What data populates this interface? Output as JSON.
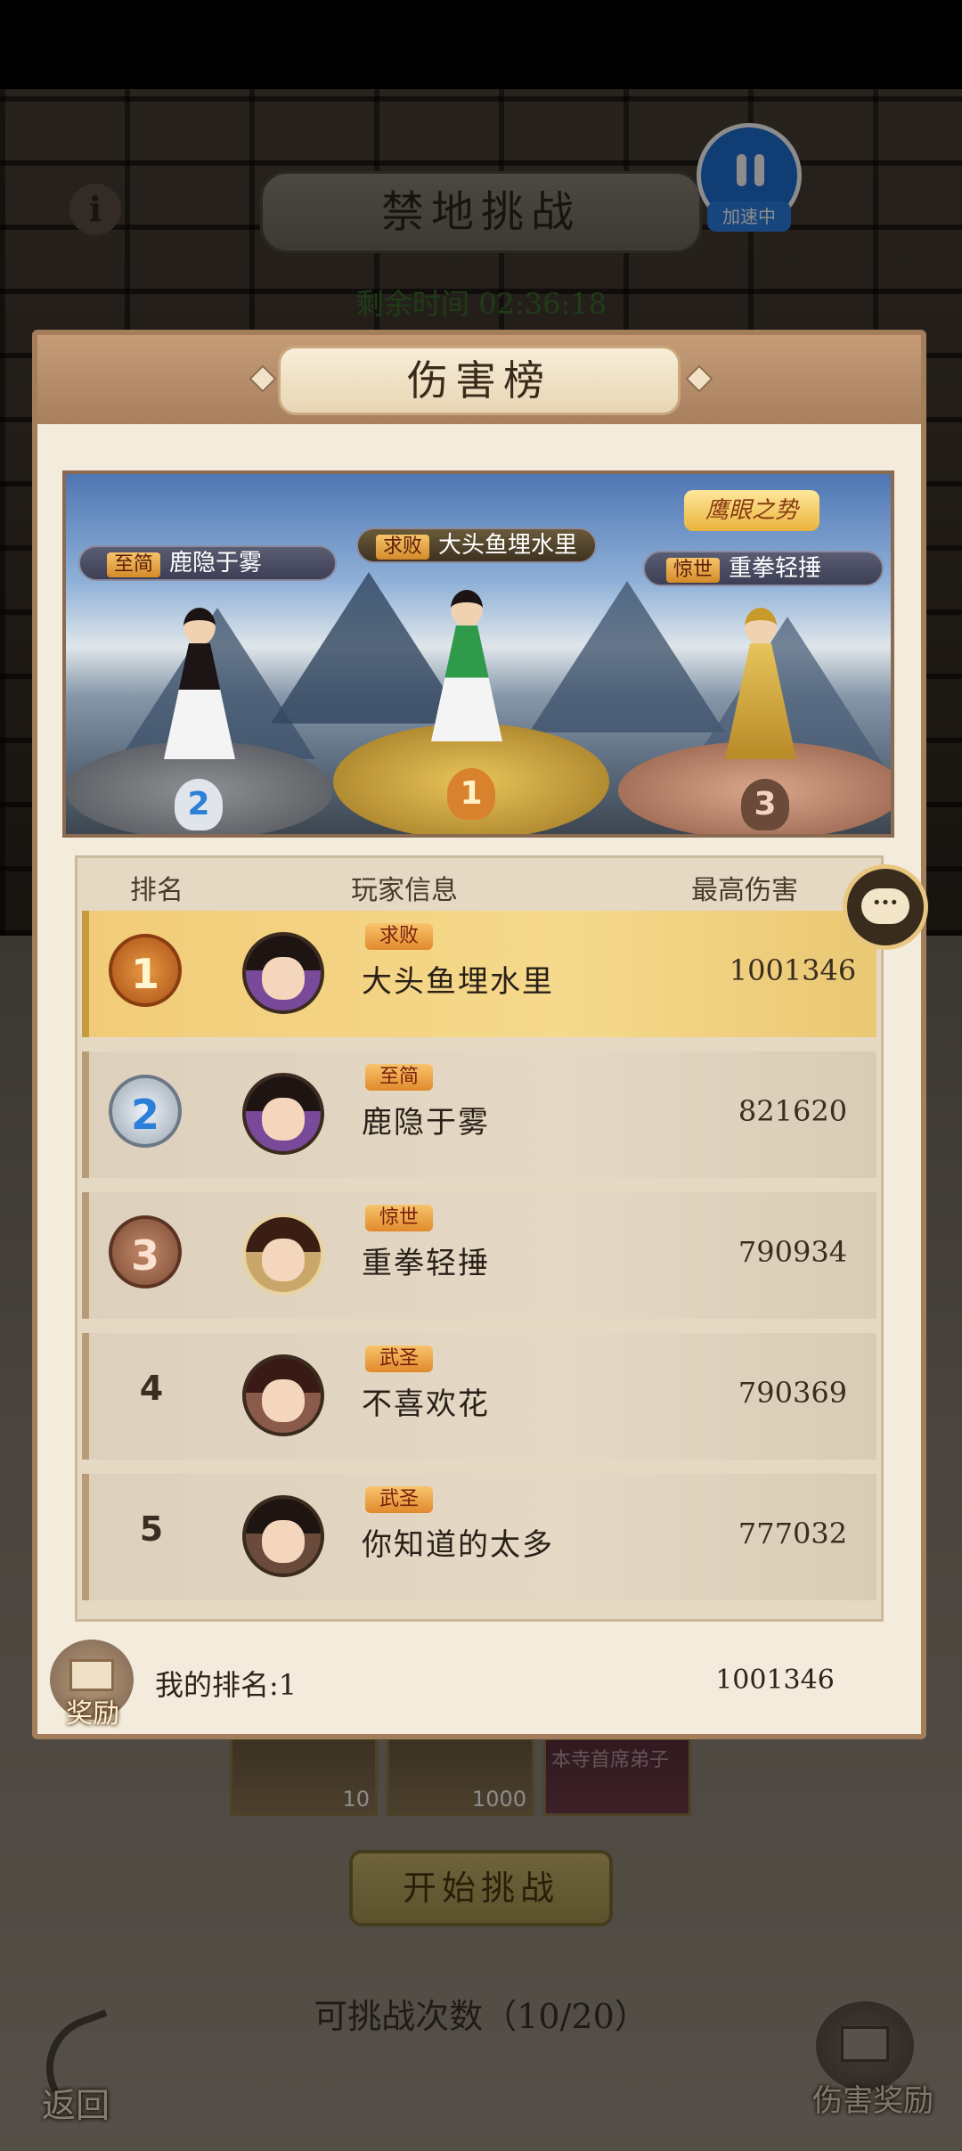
{
  "header": {
    "title": "禁地挑战",
    "speed_label": "加速中",
    "timer_label": "剩余时间",
    "timer_value": "02:36:18"
  },
  "modal": {
    "title": "伤害榜",
    "podium": {
      "special_badge": "鹰眼之势",
      "first": {
        "rank": "1",
        "title": "求败",
        "name": "大头鱼埋水里"
      },
      "second": {
        "rank": "2",
        "title": "至简",
        "name": "鹿隐于雾"
      },
      "third": {
        "rank": "3",
        "title": "惊世",
        "name": "重拳轻捶"
      }
    },
    "columns": {
      "rank": "排名",
      "player": "玩家信息",
      "damage": "最高伤害"
    },
    "rows": [
      {
        "rank": "1",
        "title": "求败",
        "name": "大头鱼埋水里",
        "damage": "1001346"
      },
      {
        "rank": "2",
        "title": "至简",
        "name": "鹿隐于雾",
        "damage": "821620"
      },
      {
        "rank": "3",
        "title": "惊世",
        "name": "重拳轻捶",
        "damage": "790934"
      },
      {
        "rank": "4",
        "title": "武圣",
        "name": "不喜欢花",
        "damage": "790369"
      },
      {
        "rank": "5",
        "title": "武圣",
        "name": "你知道的太多",
        "damage": "777032"
      }
    ],
    "my_rank_label": "我的排名:1",
    "my_damage": "1001346",
    "reward_label": "奖励"
  },
  "bottom": {
    "items": [
      {
        "qty": "10"
      },
      {
        "qty": "1000"
      },
      {
        "qty": ""
      }
    ],
    "item3_text": "本寺首席弟子",
    "start_button": "开始挑战",
    "attempts": "可挑战次数（10/20）",
    "back_label": "返回",
    "damage_reward_label": "伤害奖励"
  },
  "colors": {
    "first_row": "#f5d98c",
    "accent_blue": "#1f6fd6",
    "modal_border": "#a47d5b"
  },
  "icons": [
    "info-icon",
    "pause-icon",
    "chat-icon",
    "chest-icon",
    "back-arrow-icon",
    "medal-gold-icon",
    "medal-silver-icon",
    "medal-bronze-icon"
  ]
}
